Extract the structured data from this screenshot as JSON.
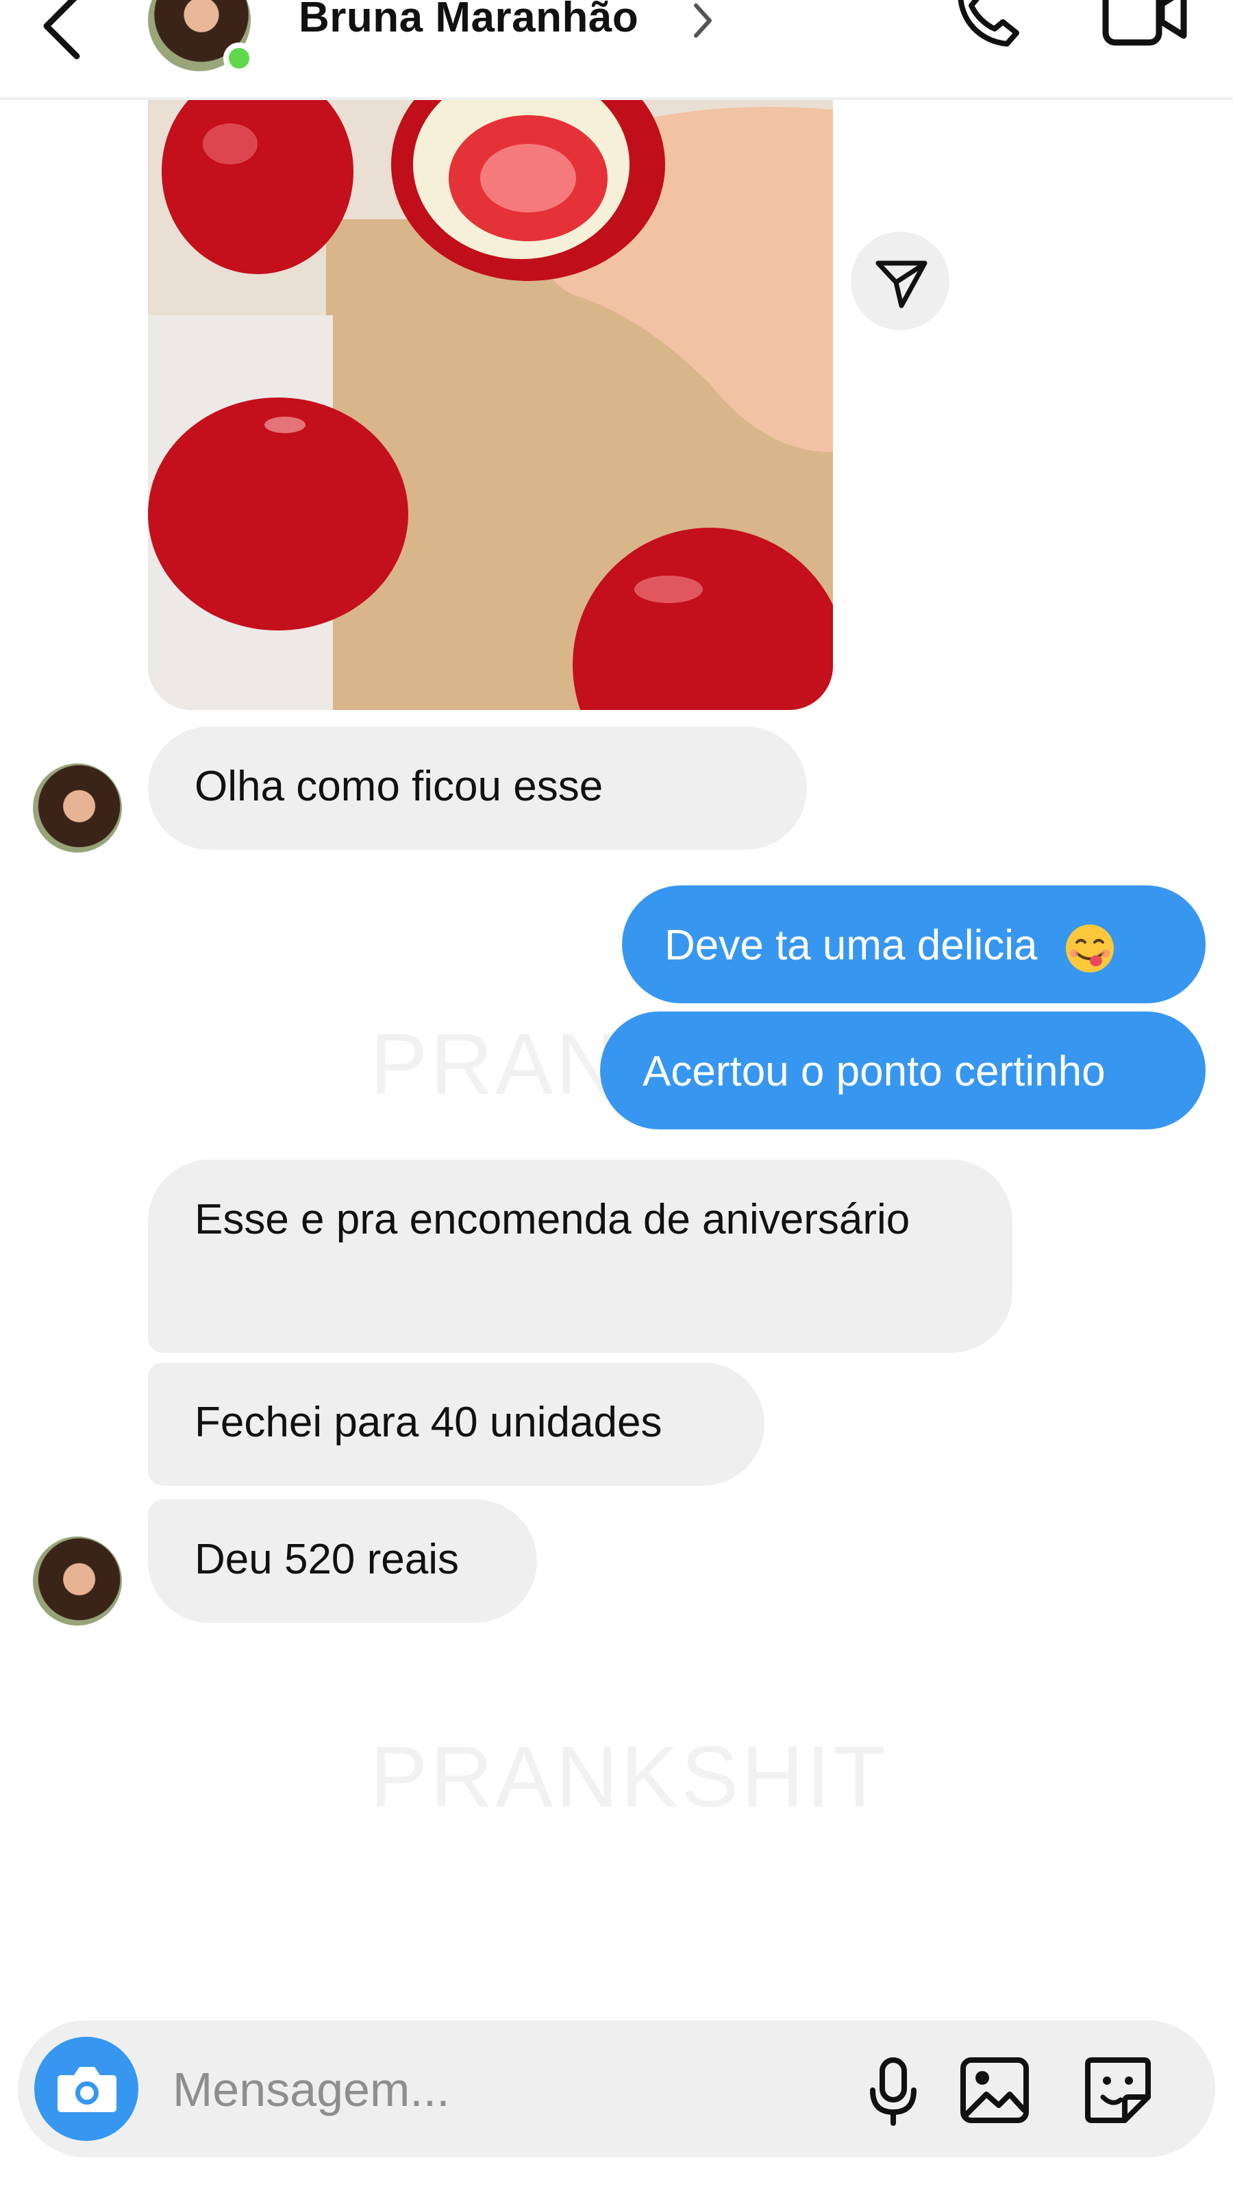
{
  "header": {
    "contact_name": "Bruna Maranhão",
    "status": "online",
    "icons": [
      "back-arrow-icon",
      "chevron-right-icon",
      "phone-icon",
      "video-camera-icon"
    ]
  },
  "media": {
    "description_icon": "photo-thumbnail",
    "share_icon": "send-paper-plane-icon"
  },
  "messages": [
    {
      "sender": "contact",
      "text": "Olha como ficou esse"
    },
    {
      "sender": "me",
      "text": "Deve ta uma delicia",
      "emoji": "face-savoring-food"
    },
    {
      "sender": "me",
      "text": "Acertou o ponto certinho"
    },
    {
      "sender": "contact",
      "text": "Esse e pra encomenda de aniversário"
    },
    {
      "sender": "contact",
      "text": "Fechei para 40 unidades"
    },
    {
      "sender": "contact",
      "text": "Deu 520 reais"
    }
  ],
  "watermark": {
    "text": "PRANKSHIT"
  },
  "composer": {
    "placeholder": "Mensagem...",
    "icons": [
      "camera-icon",
      "microphone-icon",
      "gallery-icon",
      "sticker-icon"
    ]
  },
  "colors": {
    "outgoing_bubble": "#3797f0",
    "incoming_bubble": "#efefef",
    "online_dot": "#5fd84c"
  }
}
